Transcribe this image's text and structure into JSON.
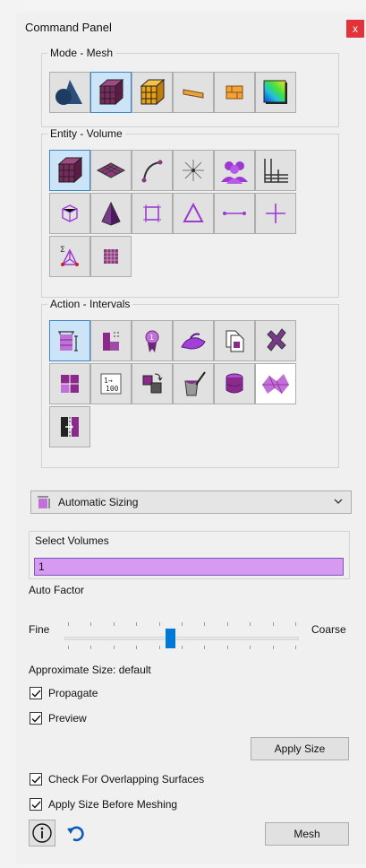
{
  "window": {
    "title": "Command Panel",
    "close": "x"
  },
  "mode_group": {
    "legend": "Mode - Mesh",
    "buttons": [
      "geometry-mode-icon",
      "mesh-mode-icon",
      "boundary-mesh-icon",
      "material-mode-icon",
      "block-mode-icon",
      "analysis-mode-icon"
    ]
  },
  "entity_group": {
    "legend": "Entity - Volume",
    "buttons": [
      "volume-icon",
      "surface-icon",
      "curve-icon",
      "vertex-icon",
      "group-icon",
      "grid-icon",
      "hex-entity-icon",
      "tet-entity-icon",
      "quad-entity-icon",
      "tri-entity-icon",
      "edge-entity-icon",
      "node-entity-icon",
      "sideset-icon",
      "mesh-grid-icon"
    ]
  },
  "action_group": {
    "legend": "Action - Intervals",
    "buttons": [
      "intervals-icon",
      "sizes-icon",
      "scheme-icon",
      "smooth-icon",
      "copy-mesh-icon",
      "delete-mesh-icon",
      "refine-icon",
      "renumber-icon",
      "swap-icon",
      "paint-icon",
      "database-icon",
      "morph-icon",
      "split-icon"
    ]
  },
  "sizing_dropdown": {
    "label": "Automatic Sizing"
  },
  "select_volumes": {
    "label": "Select Volumes",
    "value": "1"
  },
  "auto_factor": {
    "label": "Auto Factor",
    "fine": "Fine",
    "coarse": "Coarse",
    "level": 0.45
  },
  "approximate_size": {
    "label": "Approximate Size:",
    "value": "default"
  },
  "checkboxes": {
    "propagate": "Propagate",
    "preview": "Preview",
    "overlap": "Check For Overlapping Surfaces",
    "apply_before": "Apply Size Before Meshing"
  },
  "buttons": {
    "apply_size": "Apply Size",
    "mesh": "Mesh"
  },
  "colors": {
    "selected_bg": "#cce4f7",
    "input_bg": "#d79af2",
    "accent": "#0078d7",
    "close": "#e2323a"
  }
}
